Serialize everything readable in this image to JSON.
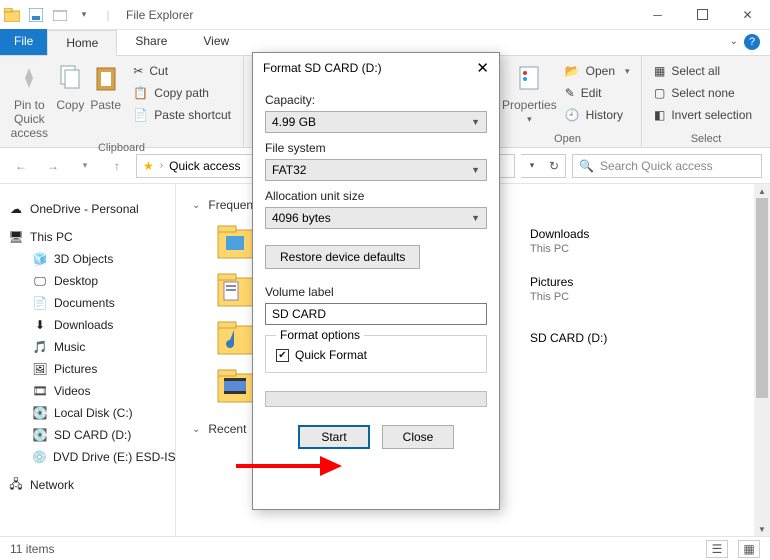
{
  "window": {
    "title": "File Explorer"
  },
  "tabs": {
    "file": "File",
    "home": "Home",
    "share": "Share",
    "view": "View"
  },
  "ribbon": {
    "pin": "Pin to Quick access",
    "copy": "Copy",
    "paste": "Paste",
    "cut": "Cut",
    "copypath": "Copy path",
    "pasteshort": "Paste shortcut",
    "clipboard": "Clipboard",
    "properties": "Properties",
    "open": "Open",
    "edit": "Edit",
    "history": "History",
    "open_group": "Open",
    "selectall": "Select all",
    "selectnone": "Select none",
    "invert": "Invert selection",
    "select_group": "Select"
  },
  "addr": {
    "location": "Quick access",
    "search_ph": "Search Quick access"
  },
  "tree": {
    "onedrive": "OneDrive - Personal",
    "thispc": "This PC",
    "o3d": "3D Objects",
    "desktop": "Desktop",
    "documents": "Documents",
    "downloads": "Downloads",
    "music": "Music",
    "pictures": "Pictures",
    "videos": "Videos",
    "localc": "Local Disk (C:)",
    "sdcard": "SD CARD (D:)",
    "dvd": "DVD Drive (E:) ESD-IS",
    "network": "Network"
  },
  "content": {
    "frequent": "Frequent",
    "recent": "Recent",
    "downloads": "Downloads",
    "pictures": "Pictures",
    "sdcard": "SD CARD (D:)",
    "thispc": "This PC"
  },
  "status": {
    "items": "11 items"
  },
  "dialog": {
    "title": "Format SD CARD (D:)",
    "capacity_l": "Capacity:",
    "capacity_v": "4.99 GB",
    "fs_l": "File system",
    "fs_v": "FAT32",
    "alloc_l": "Allocation unit size",
    "alloc_v": "4096 bytes",
    "restore": "Restore device defaults",
    "vol_l": "Volume label",
    "vol_v": "SD CARD",
    "fo_l": "Format options",
    "quick": "Quick Format",
    "start": "Start",
    "close": "Close"
  }
}
